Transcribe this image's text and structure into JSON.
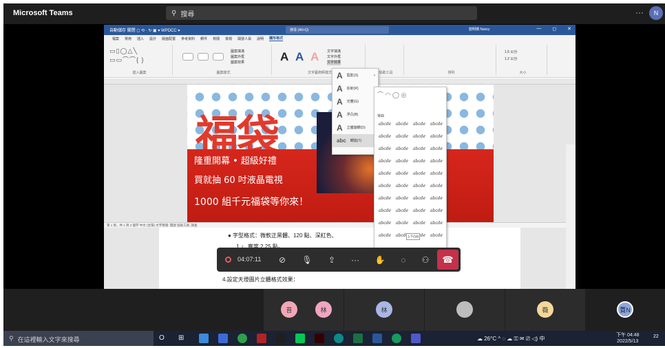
{
  "teams": {
    "title": "Microsoft Teams",
    "search_placeholder": "搜尋",
    "more": "···",
    "avatar_initials": "N"
  },
  "word": {
    "title_bar": "自動儲存 關閉  ◻ ⟲ · ↻ ▣ ▾   WPDCC ▾",
    "search": "搜尋 (Alt+Q)",
    "user": "劉明嬌 Nancy",
    "window_buttons": [
      "—",
      "◻",
      "✕"
    ],
    "tabs": [
      "檔案",
      "常用",
      "插入",
      "設計",
      "版面配置",
      "參考資料",
      "郵件",
      "校閱",
      "檢視",
      "開發人員",
      "說明",
      "圖形格式"
    ],
    "active_tab": "圖形格式",
    "ribbon_groups": [
      "插入圖案",
      "圖案樣式",
      "文字藝術師樣式",
      "協助工具",
      "排列",
      "大小"
    ],
    "shape_fill_label": "圖案填滿",
    "shape_outline_label": "圖案外框",
    "shape_effects_label": "圖案效果",
    "text_fill_label": "文字填滿",
    "text_outline_label": "文字外框",
    "text_effects_label": "文字效果",
    "size_height": "1.5 公分",
    "size_width": "1.2 公分"
  },
  "document": {
    "big_title": "福袋",
    "line1": "隆重開幕 • 超級好禮",
    "line2": "買就抽 60 吋液晶電視",
    "line3": "1000 組千元福袋等你來！",
    "status": "第 1 頁，共 1 頁   2 個字   中文 (台灣)   文字預測: 開啟   協助工具: 調查",
    "item1": "● 字型格式：微軟正黑體、120 點、深紅色、",
    "item2": "1.」 寬度 2.25 點。",
    "item3": "4.設定天燈圖片立體格式效果："
  },
  "context_menu": {
    "items": [
      {
        "label": "陰影(S)"
      },
      {
        "label": "反射(R)"
      },
      {
        "label": "光暈(G)"
      },
      {
        "label": "浮凸(B)"
      },
      {
        "label": "立體旋轉(D)"
      },
      {
        "label": "轉換(T)"
      }
    ]
  },
  "gallery": {
    "header": "彎曲",
    "sample": "abcde",
    "tooltip": "上下凸出"
  },
  "call_controls": {
    "timer": "04:07:11",
    "buttons": [
      "camera-off",
      "mic-off",
      "share",
      "more",
      "raise-hand",
      "chat",
      "participants",
      "leave"
    ]
  },
  "participants": [
    {
      "initial": "苔",
      "color": "#f2a6b8"
    },
    {
      "initial": "林",
      "color": "#f1a5c0"
    },
    {
      "initial": "林",
      "color": "#a9b6e6"
    },
    {
      "initial": "",
      "color": "#bdbdbd"
    },
    {
      "initial": "薇",
      "color": "#f4d89a"
    },
    {
      "initial": "賈N",
      "color": "#8fa7d8"
    }
  ],
  "taskbar": {
    "search_placeholder": "在這裡輸入文字來搜尋",
    "weather": "26°C",
    "tray": "^ ◌ ☁ ⚿ ✉ ⎚ ◁) 中",
    "time": "下午 04:48",
    "date": "2022/5/13",
    "notification_count": "22"
  }
}
